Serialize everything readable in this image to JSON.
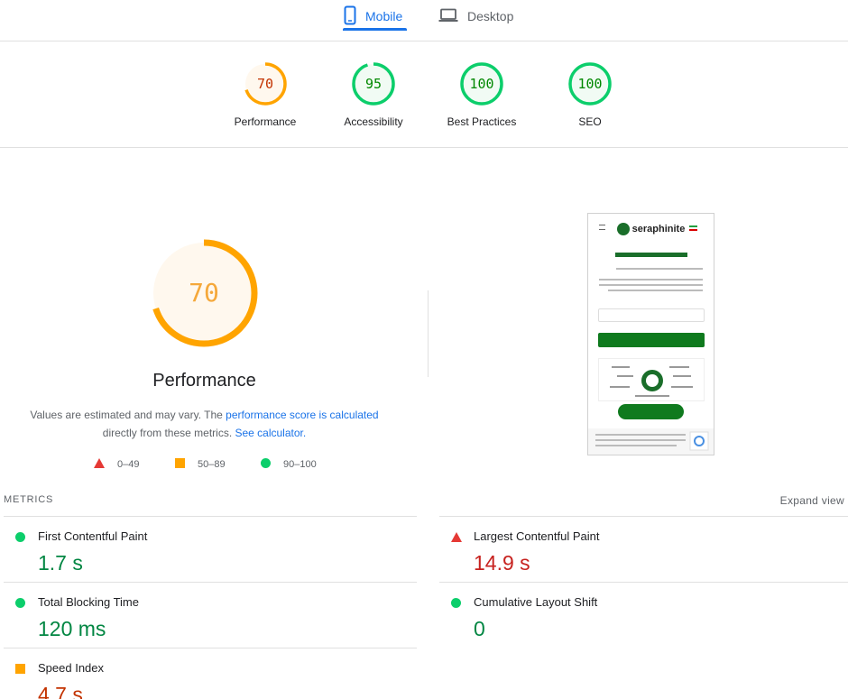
{
  "tabs": {
    "mobile_label": "Mobile",
    "desktop_label": "Desktop",
    "active": "Mobile"
  },
  "categories": [
    {
      "label": "Performance",
      "score": "70",
      "level": "average",
      "score_fraction": 0.7
    },
    {
      "label": "Accessibility",
      "score": "95",
      "level": "pass",
      "score_fraction": 0.95
    },
    {
      "label": "Best Practices",
      "score": "100",
      "level": "pass",
      "score_fraction": 1.0
    },
    {
      "label": "SEO",
      "score": "100",
      "level": "pass",
      "score_fraction": 1.0
    }
  ],
  "performance": {
    "score": "70",
    "score_fraction": 0.7,
    "title": "Performance",
    "desc_part1": "Values are estimated and may vary. The ",
    "link_score": "performance score is calculated",
    "desc_part2": " directly from these metrics. ",
    "link_calculator": "See calculator.",
    "legend": [
      {
        "range": "0–49",
        "shape": "triangle",
        "color": "#e53935"
      },
      {
        "range": "50–89",
        "shape": "square",
        "color": "#ffa400"
      },
      {
        "range": "90–100",
        "shape": "circle",
        "color": "#0cce6b"
      }
    ]
  },
  "screenshot": {
    "site_name": "seraphinite"
  },
  "metrics": {
    "heading": "METRICS",
    "expand_label": "Expand view",
    "items": [
      {
        "label": "First Contentful Paint",
        "value": "1.7 s",
        "level": "pass"
      },
      {
        "label": "Largest Contentful Paint",
        "value": "14.9 s",
        "level": "fail"
      },
      {
        "label": "Total Blocking Time",
        "value": "120 ms",
        "level": "pass"
      },
      {
        "label": "Cumulative Layout Shift",
        "value": "0",
        "level": "pass"
      },
      {
        "label": "Speed Index",
        "value": "4.7 s",
        "level": "average"
      }
    ]
  },
  "colors": {
    "accent": "#1a73e8",
    "pass": "#0cce6b",
    "average": "#ffa400",
    "fail": "#e53935"
  }
}
